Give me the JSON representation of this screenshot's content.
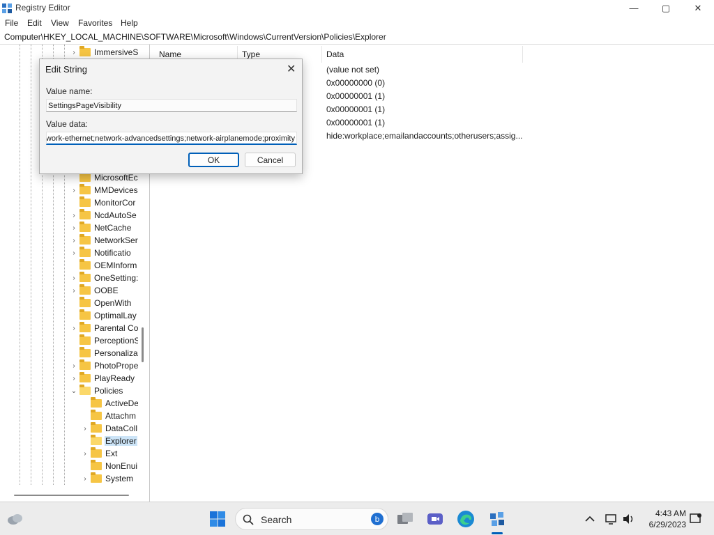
{
  "window": {
    "title": "Registry Editor",
    "controls": {
      "minimize": "—",
      "maximize": "▢",
      "close": "✕"
    }
  },
  "menu": [
    "File",
    "Edit",
    "View",
    "Favorites",
    "Help"
  ],
  "address": "Computer\\HKEY_LOCAL_MACHINE\\SOFTWARE\\Microsoft\\Windows\\CurrentVersion\\Policies\\Explorer",
  "tree": {
    "items": [
      {
        "label": "ImmersiveS",
        "expander": "›"
      },
      {
        "label": "MicrosoftEc",
        "expander": ""
      },
      {
        "label": "MMDevices",
        "expander": "›"
      },
      {
        "label": "MonitorCor",
        "expander": ""
      },
      {
        "label": "NcdAutoSe",
        "expander": "›"
      },
      {
        "label": "NetCache",
        "expander": "›"
      },
      {
        "label": "NetworkSer",
        "expander": "›"
      },
      {
        "label": "Notificatio",
        "expander": "›"
      },
      {
        "label": "OEMInform",
        "expander": ""
      },
      {
        "label": "OneSetting:",
        "expander": "›"
      },
      {
        "label": "OOBE",
        "expander": "›"
      },
      {
        "label": "OpenWith",
        "expander": ""
      },
      {
        "label": "OptimalLay",
        "expander": ""
      },
      {
        "label": "Parental Co",
        "expander": "›"
      },
      {
        "label": "PerceptionS",
        "expander": ""
      },
      {
        "label": "Personalizat",
        "expander": ""
      },
      {
        "label": "PhotoPrope",
        "expander": "›"
      },
      {
        "label": "PlayReady",
        "expander": "›"
      },
      {
        "label": "Policies",
        "expander": "⌄"
      },
      {
        "label": "ActiveDe",
        "expander": ""
      },
      {
        "label": "Attachm",
        "expander": ""
      },
      {
        "label": "DataColl",
        "expander": "›"
      },
      {
        "label": "Explorer",
        "expander": ""
      },
      {
        "label": "Ext",
        "expander": "›"
      },
      {
        "label": "NonEnui",
        "expander": ""
      },
      {
        "label": "System",
        "expander": "›"
      }
    ]
  },
  "list": {
    "columns": [
      "Name",
      "Type",
      "Data"
    ],
    "data": [
      "(value not set)",
      "0x00000000 (0)",
      "0x00000001 (1)",
      "0x00000001 (1)",
      "0x00000001 (1)",
      "hide:workplace;emailandaccounts;otherusers;assig..."
    ]
  },
  "dialog": {
    "title": "Edit String",
    "close": "✕",
    "value_name_label": "Value name:",
    "value_name": "SettingsPageVisibility",
    "value_data_label": "Value data:",
    "value_data": "network-ethernet;network-advancedsettings;network-airplanemode;proximity",
    "ok": "OK",
    "cancel": "Cancel"
  },
  "taskbar": {
    "search_label": "Search",
    "time": "4:43 AM",
    "date": "6/29/2023",
    "icons": [
      "weather-icon",
      "start-icon",
      "search-icon",
      "bing-icon",
      "task-view-icon",
      "teams-icon",
      "edge-icon",
      "regedit-icon",
      "chevron-up-icon",
      "network-icon",
      "volume-icon",
      "notification-icon"
    ]
  },
  "colors": {
    "accent": "#005fb8",
    "folder": "#f6c544",
    "selection": "#cce4f7"
  }
}
